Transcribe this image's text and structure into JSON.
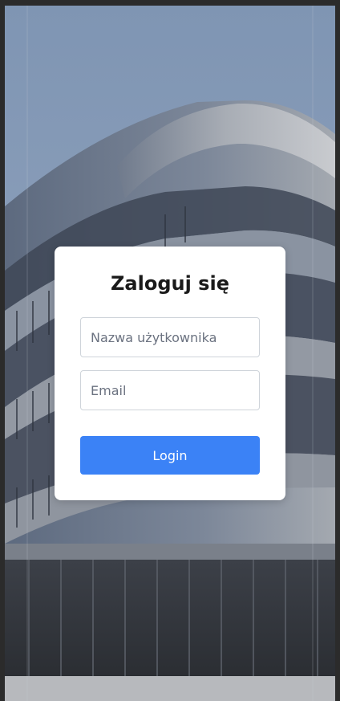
{
  "login": {
    "title": "Zaloguj się",
    "username_placeholder": "Nazwa użytkownika",
    "email_placeholder": "Email",
    "submit_label": "Login"
  },
  "theme": {
    "accent": "#3b82f6",
    "card_bg": "#ffffff",
    "text": "#1a1a1a"
  }
}
